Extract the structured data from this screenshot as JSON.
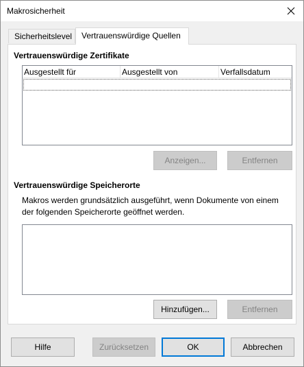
{
  "window": {
    "title": "Makrosicherheit",
    "close_icon": "close-icon"
  },
  "tabs": [
    {
      "label": "Sicherheitslevel",
      "active": false
    },
    {
      "label": "Vertrauenswürdige Quellen",
      "active": true
    }
  ],
  "certificates": {
    "title": "Vertrauenswürdige Zertifikate",
    "columns": [
      "Ausgestellt für",
      "Ausgestellt von",
      "Verfallsdatum"
    ],
    "rows": [],
    "show_label": "Anzeigen...",
    "remove_label": "Entfernen"
  },
  "locations": {
    "title": "Vertrauenswürdige Speicherorte",
    "description": "Makros werden grundsätzlich ausgeführt, wenn Dokumente von einem der folgenden Speicherorte geöffnet werden.",
    "items": [],
    "add_label": "Hinzufügen...",
    "remove_label": "Entfernen"
  },
  "footer": {
    "help_label": "Hilfe",
    "reset_label": "Zurücksetzen",
    "ok_label": "OK",
    "cancel_label": "Abbrechen"
  },
  "colors": {
    "accent": "#0078d7",
    "dialog_bg": "#f0f0f0",
    "panel_bg": "#ffffff"
  }
}
